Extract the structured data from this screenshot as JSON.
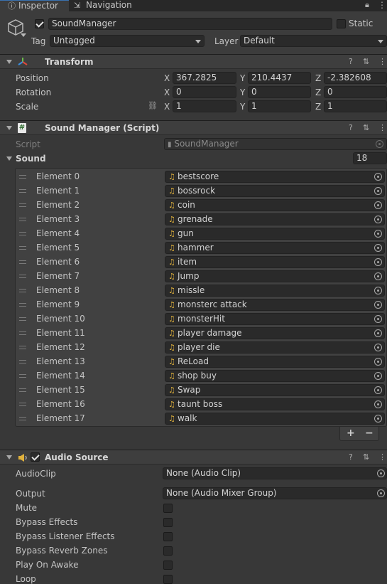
{
  "tabs": {
    "inspector": "Inspector",
    "navigation": "Navigation"
  },
  "object": {
    "name": "SoundManager",
    "static_label": "Static",
    "tag_label": "Tag",
    "tag_value": "Untagged",
    "layer_label": "Layer",
    "layer_value": "Default"
  },
  "transform": {
    "title": "Transform",
    "position": {
      "label": "Position",
      "x": "367.2825",
      "y": "210.4437",
      "z": "-2.382608"
    },
    "rotation": {
      "label": "Rotation",
      "x": "0",
      "y": "0",
      "z": "0"
    },
    "scale": {
      "label": "Scale",
      "x": "1",
      "y": "1",
      "z": "1"
    },
    "axis": {
      "x": "X",
      "y": "Y",
      "z": "Z"
    }
  },
  "sound_manager": {
    "title": "Sound Manager (Script)",
    "script_label": "Script",
    "script_value": "SoundManager",
    "sound_label": "Sound",
    "sound_count": "18",
    "elements": [
      {
        "label": "Element 0",
        "value": "bestscore"
      },
      {
        "label": "Element 1",
        "value": "bossrock"
      },
      {
        "label": "Element 2",
        "value": "coin"
      },
      {
        "label": "Element 3",
        "value": "grenade"
      },
      {
        "label": "Element 4",
        "value": "gun"
      },
      {
        "label": "Element 5",
        "value": "hammer"
      },
      {
        "label": "Element 6",
        "value": "item"
      },
      {
        "label": "Element 7",
        "value": "Jump"
      },
      {
        "label": "Element 8",
        "value": "missle"
      },
      {
        "label": "Element 9",
        "value": "monsterc attack"
      },
      {
        "label": "Element 10",
        "value": "monsterHit"
      },
      {
        "label": "Element 11",
        "value": "player damage"
      },
      {
        "label": "Element 12",
        "value": "player die"
      },
      {
        "label": "Element 13",
        "value": "ReLoad"
      },
      {
        "label": "Element 14",
        "value": "shop buy"
      },
      {
        "label": "Element 15",
        "value": "Swap"
      },
      {
        "label": "Element 16",
        "value": "taunt boss"
      },
      {
        "label": "Element 17",
        "value": "walk"
      }
    ],
    "add": "+",
    "remove": "−"
  },
  "audio_source": {
    "title": "Audio Source",
    "audioclip_label": "AudioClip",
    "audioclip_value": "None (Audio Clip)",
    "output_label": "Output",
    "output_value": "None (Audio Mixer Group)",
    "mute": "Mute",
    "bypass_effects": "Bypass Effects",
    "bypass_listener": "Bypass Listener Effects",
    "bypass_reverb": "Bypass Reverb Zones",
    "play_on_awake": "Play On Awake",
    "loop": "Loop"
  },
  "header_icons": {
    "help": "?",
    "settings": "⇅",
    "menu": "⋮"
  },
  "colors": {
    "accent": "#3a72b0",
    "background": "#383838",
    "field": "#2a2a2a",
    "audio_icon": "#e0b13c"
  }
}
